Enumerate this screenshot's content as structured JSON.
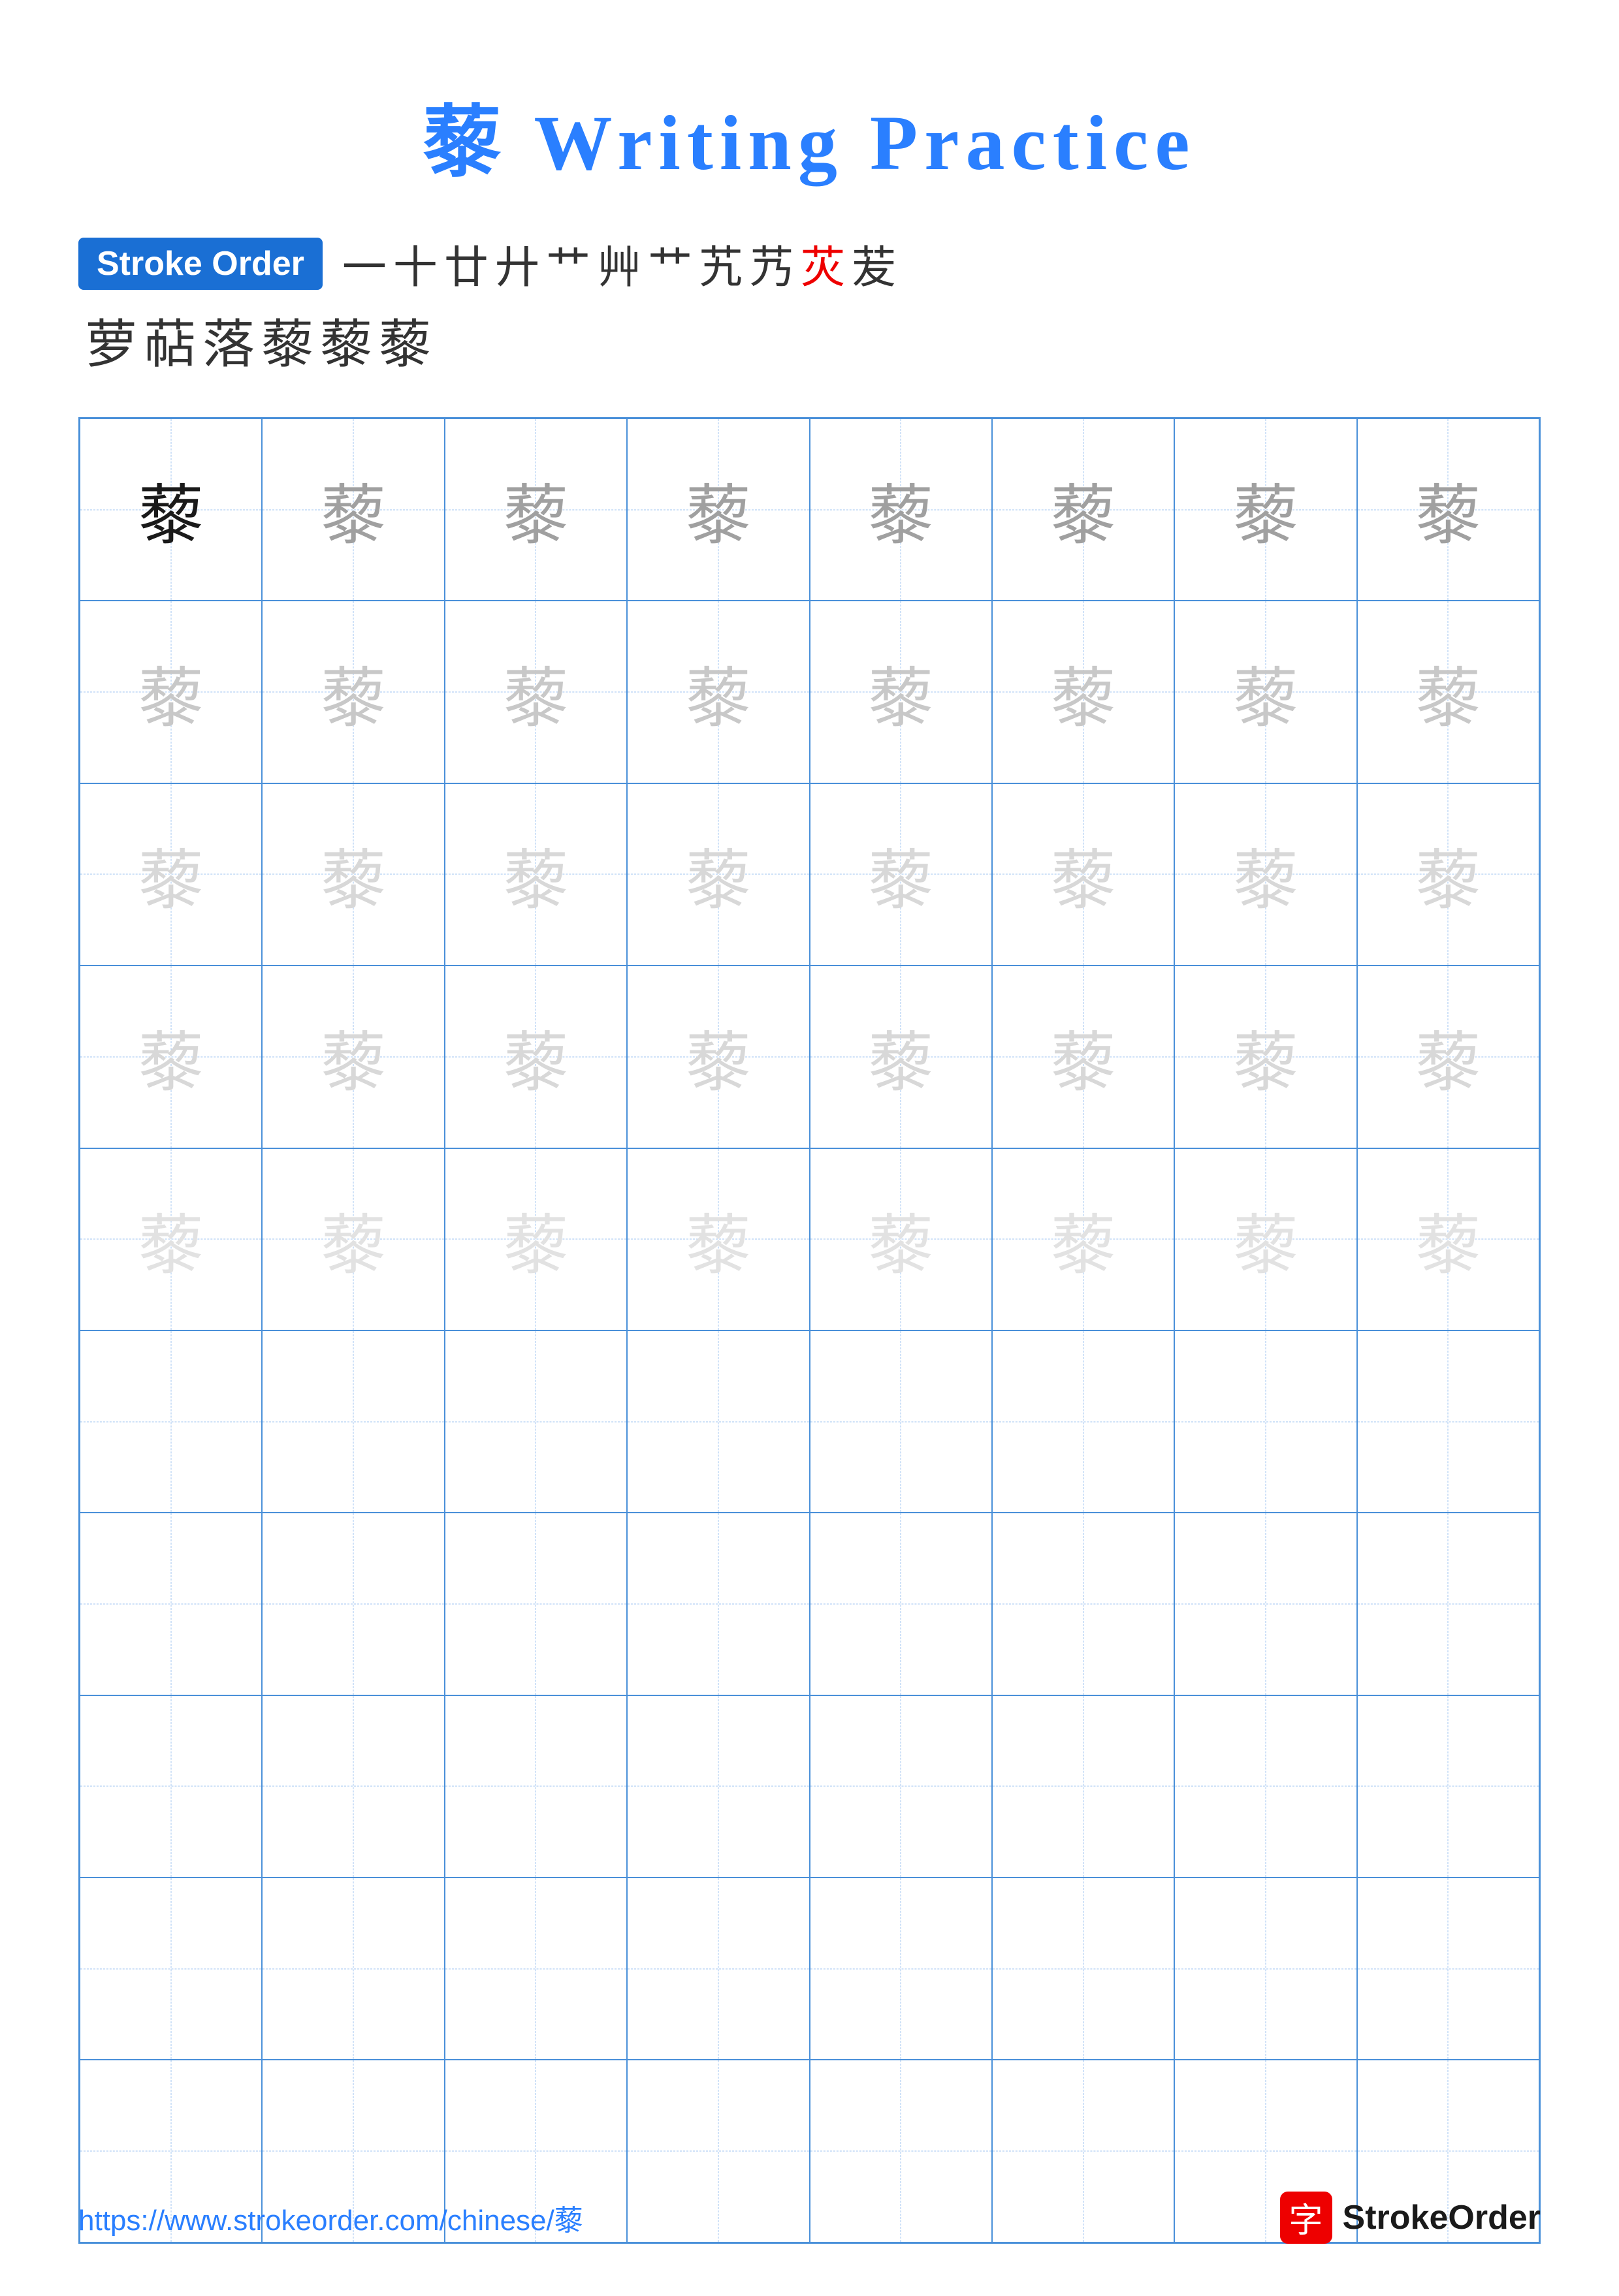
{
  "title": {
    "char": "藜",
    "text": " Writing Practice"
  },
  "stroke_order": {
    "badge_label": "Stroke Order",
    "row1_chars": [
      "一",
      "十",
      "廿",
      "廾",
      "艹",
      "艸",
      "艹",
      "艽",
      "艿",
      "苂",
      "苃"
    ],
    "row1_red_index": 9,
    "row2_chars": [
      "萝",
      "萜",
      "落",
      "藜",
      "藜",
      "藜"
    ]
  },
  "character": "藜",
  "grid": {
    "cols": 8,
    "rows": 10,
    "practice_rows": 5,
    "empty_rows": 5
  },
  "footer": {
    "url": "https://www.strokeorder.com/chinese/藜",
    "logo_char": "字",
    "logo_text": "StrokeOrder"
  }
}
